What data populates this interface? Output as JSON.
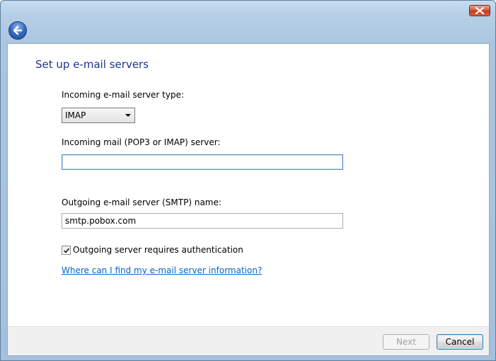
{
  "window": {
    "close_icon": "close-x-icon",
    "back_icon": "back-arrow-icon"
  },
  "page": {
    "title": "Set up e-mail servers"
  },
  "form": {
    "server_type_label": "Incoming e-mail server type:",
    "server_type_value": "IMAP",
    "incoming_label": "Incoming mail (POP3 or IMAP) server:",
    "incoming_value": "",
    "outgoing_label": "Outgoing e-mail server (SMTP) name:",
    "outgoing_value": "smtp.pobox.com",
    "auth_label": "Outgoing server requires authentication",
    "auth_checked": true,
    "help_link": "Where can I find my e-mail server information?"
  },
  "footer": {
    "next_label": "Next",
    "cancel_label": "Cancel"
  }
}
